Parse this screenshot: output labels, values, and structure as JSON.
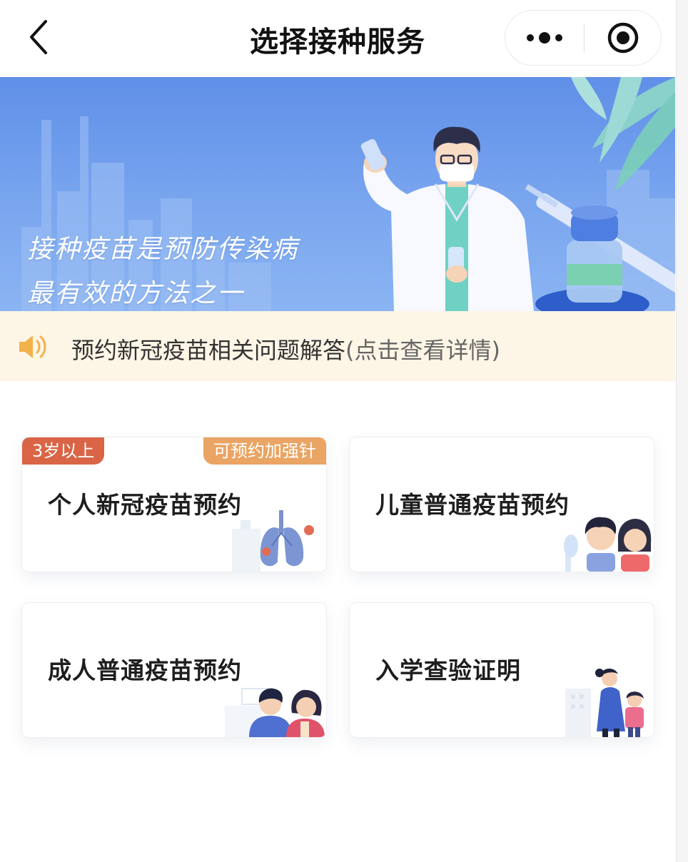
{
  "header": {
    "title": "选择接种服务",
    "back_icon": "chevron-left-icon",
    "more_icon": "more-dots-icon",
    "close_icon": "target-circle-icon"
  },
  "banner": {
    "slogan_line1": "接种疫苗是预防传染病",
    "slogan_line2": "最有效的方法之一"
  },
  "notice": {
    "icon": "speaker-icon",
    "text": "预约新冠疫苗相关问题解答",
    "suffix": "(点击查看详情)"
  },
  "services": [
    {
      "title": "个人新冠疫苗预约",
      "badge_left": "3岁以上",
      "badge_right": "可预约加强针",
      "icon": "lungs-illustration"
    },
    {
      "title": "儿童普通疫苗预约",
      "icon": "children-illustration"
    },
    {
      "title": "成人普通疫苗预约",
      "icon": "adults-illustration"
    },
    {
      "title": "入学查验证明",
      "icon": "mother-child-illustration"
    }
  ],
  "colors": {
    "banner_blue": "#6f9cec",
    "notice_bg": "#fdf5e6",
    "badge_red": "#d96546",
    "badge_orange": "#eaa463"
  }
}
